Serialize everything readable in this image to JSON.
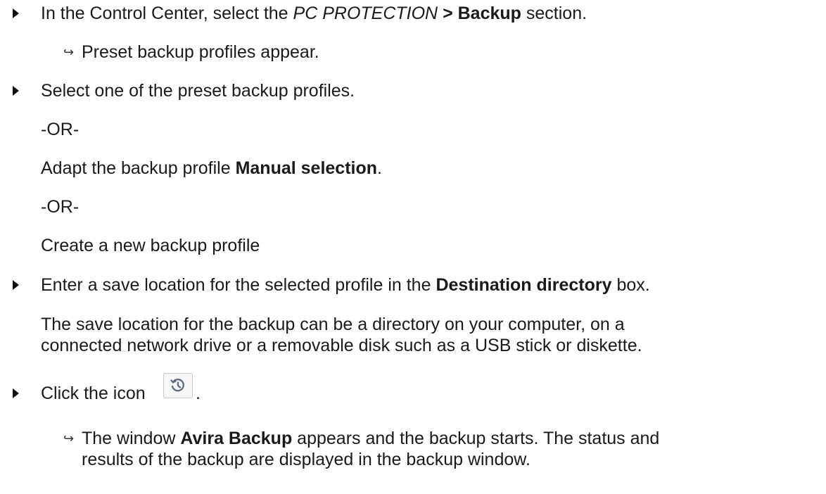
{
  "steps": {
    "s1": {
      "text_before": "In the Control Center, select the ",
      "italic": "PC PROTECTION",
      "sep": " > ",
      "bold": "Backup",
      "text_after": " section."
    },
    "r1": "Preset backup profiles appear.",
    "s2": "Select one of the preset backup profiles.",
    "or1": "-OR-",
    "adapt": {
      "text_before": "Adapt the backup profile ",
      "bold": "Manual selection",
      "text_after": "."
    },
    "or2": "-OR-",
    "create": "Create a new backup profile",
    "s3": {
      "text_before": "Enter a save location for the selected profile in the ",
      "bold": "Destination directory",
      "text_after": " box."
    },
    "note_line1": "The save location for the backup can be a directory on your computer, on a",
    "note_line2": "connected network drive or a removable disk such as a USB stick or diskette.",
    "s4": {
      "text_before": "Click the icon ",
      "text_after": "."
    },
    "r2": {
      "text_before": "The window ",
      "bold": "Avira Backup",
      "text_after": " appears and the backup starts. The status and",
      "line2": "results of the backup are displayed in the backup window."
    }
  },
  "icons": {
    "bullet": "triangle-bullet-icon",
    "result": "result-arrow-icon",
    "backup": "history-clock-icon"
  }
}
